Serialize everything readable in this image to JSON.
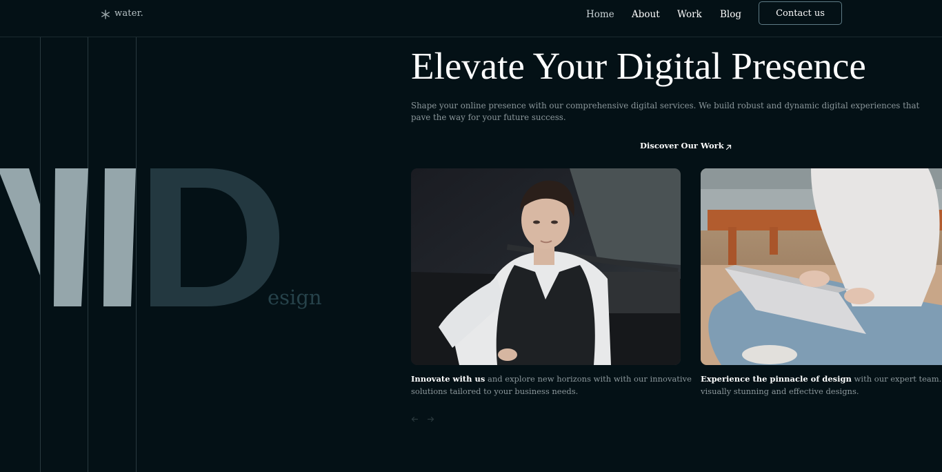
{
  "header": {
    "logo_text": "water.",
    "nav": [
      {
        "label": "Home"
      },
      {
        "label": "About"
      },
      {
        "label": "Work"
      },
      {
        "label": "Blog"
      }
    ],
    "contact_label": "Contact us"
  },
  "decor": {
    "design_word": "esign"
  },
  "hero": {
    "title": "Elevate Your Digital Presence",
    "description": "Shape your online presence with our comprehensive digital services. We build robust and dynamic digital experiences that pave the way for your future success.",
    "cta_label": "Discover Our Work"
  },
  "cards": [
    {
      "bold": "Innovate with us",
      "text_line1": " and explore new horizons with with our innovative",
      "text_line2": "solutions tailored to your business needs."
    },
    {
      "bold": "Experience the pinnacle of design",
      "text_line1": " with our expert team. Creating",
      "text_line2": "visually stunning and effective designs."
    }
  ],
  "icons": {
    "logo": "asterisk-icon",
    "cta": "arrow-up-right-icon",
    "prev": "arrow-left-icon",
    "next": "arrow-right-icon"
  },
  "colors": {
    "background": "#041116",
    "accent_border": "#5f7c86",
    "big_letters": "#95a6ab",
    "big_letters_dark": "#233840"
  }
}
